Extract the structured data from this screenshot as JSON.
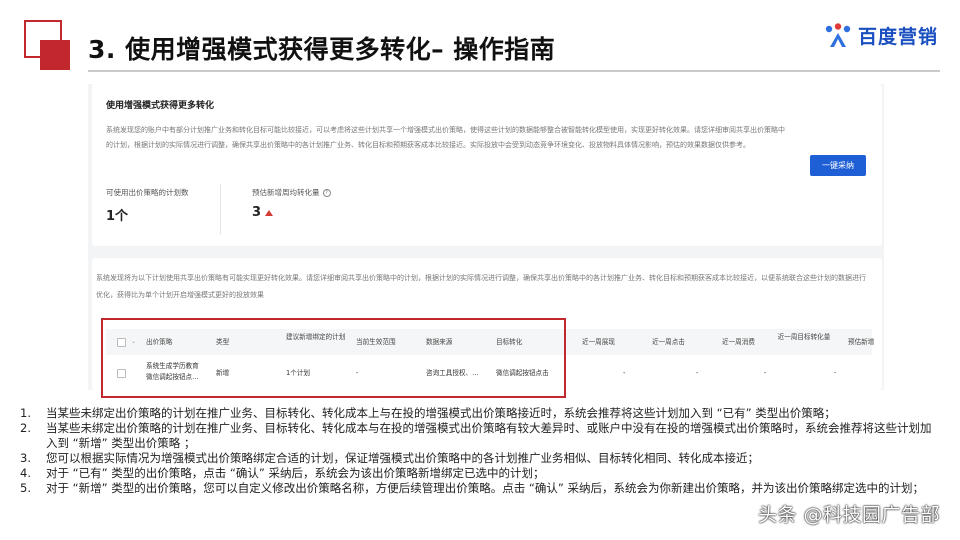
{
  "slide": {
    "title": "3. 使用增强模式获得更多转化– 操作指南",
    "logo_text": "百度营销",
    "watermark": "头条 @科技园广告部"
  },
  "colors": {
    "accent": "#c0282d",
    "primary_button": "#1f5fd6",
    "logo": "#1a4fc0"
  },
  "card": {
    "title": "使用增强模式获得更多转化",
    "description": "系统发现您的账户中有部分计划推广业务和转化目标可能比较接近，可以考虑将这些计划共享一个增强模式出价策略，使得这些计划的数据能够整合被智能转化模型使用，实现更好转化效果。请您详细审阅共享出价策略中的计划，根据计划的实际情况进行调整，确保共享出价策略中的各计划推广业务、转化目标和预期获客成本比较接近。实际投放中会受到动态竞争环境变化、投放物料具体情况影响，预估的效果数据仅供参考。",
    "button_label": "一键采纳",
    "metrics": [
      {
        "label": "可使用出价策略的计划数",
        "value": "1个"
      },
      {
        "label": "预估新增周均转化量",
        "value": "3"
      }
    ]
  },
  "table_section": {
    "description": "系统发现将为以下计划使用共享出价策略有可能实现更好转化效果。请您详细审阅共享出价策略中的计划，根据计划的实际情况进行调整，确保共享出价策略中的各计划推广业务、转化目标和预期获客成本比较接近，以便系统联合这些计划的数据进行优化，获得比为单个计划开启增强模式更好的投放效果",
    "columns": [
      "出价策略",
      "类型",
      "建议新增绑定的计划",
      "当前生效范围",
      "数据来源",
      "目标转化",
      "近一周展现",
      "近一周点击",
      "近一周消费",
      "近一周目标转化量",
      "预估新增"
    ],
    "rows": [
      {
        "strategy_line1": "系统生成学历教育",
        "strategy_line2": "微信调起按钮点…",
        "type": "新增",
        "plans": "1个计划",
        "scope": "-",
        "source": "咨询工具授权、…",
        "target": "微信调起按钮点击",
        "impr": "-",
        "clicks": "-",
        "spend": "-",
        "conv": "-"
      }
    ]
  },
  "notes": [
    {
      "num": "1.",
      "text": "当某些未绑定出价策略的计划在推广业务、目标转化、转化成本上与在投的增强模式出价策略接近时，系统会推荐将这些计划加入到 “已有” 类型出价策略；"
    },
    {
      "num": "2.",
      "text": "当某些未绑定出价策略的计划在推广业务、目标转化、转化成本与在投的增强模式出价策略有较大差异时、或账户中没有在投的增强模式出价策略时，系统会推荐将这些计划加入到 “新增” 类型出价策略 ；"
    },
    {
      "num": "3.",
      "text": "您可以根据实际情况为增强模式出价策略绑定合适的计划，保证增强模式出价策略中的各计划推广业务相似、目标转化相同、转化成本接近；"
    },
    {
      "num": "4.",
      "text": "对于 “已有” 类型的出价策略，点击 “确认” 采纳后，系统会为该出价策略新增绑定已选中的计划；"
    },
    {
      "num": "5.",
      "text": "对于 “新增” 类型的出价策略，您可以自定义修改出价策略名称，方便后续管理出价策略。点击 “确认” 采纳后，系统会为你新建出价策略，并为该出价策略绑定选中的计划；"
    }
  ]
}
